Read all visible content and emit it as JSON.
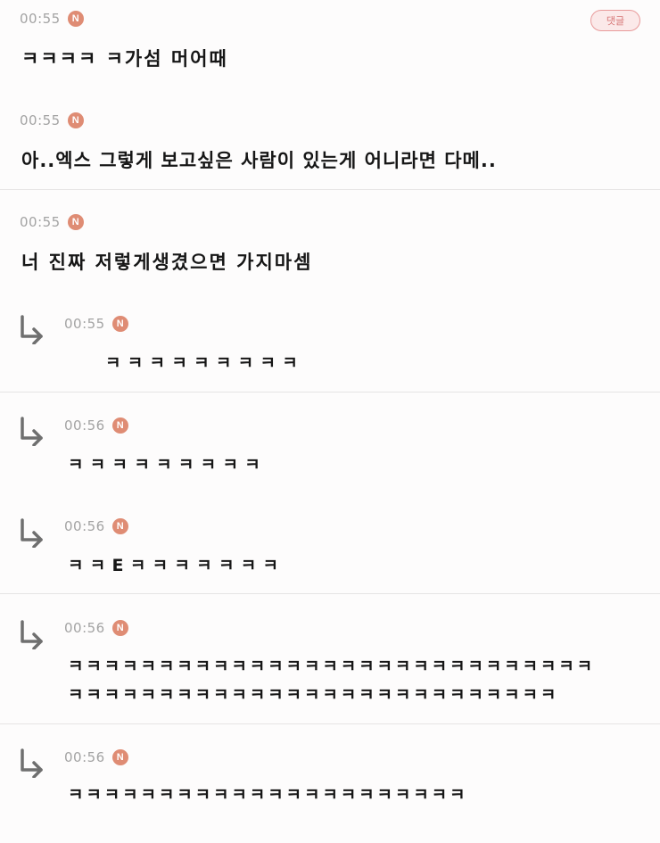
{
  "reply_button_label": "댓글",
  "comments": [
    {
      "time": "00:55",
      "badge": "N",
      "text": "ㅋㅋㅋㅋ ㅋ가섬 머어때"
    },
    {
      "time": "00:55",
      "badge": "N",
      "text": "아..엑스 그렇게 보고싶은 사람이 있는게 어니라면 다메.."
    },
    {
      "time": "00:55",
      "badge": "N",
      "text": "너 진짜 저렇게생겼으면 가지마셈"
    }
  ],
  "replies": [
    {
      "time": "00:55",
      "badge": "N",
      "lines": [
        "ㅋㅋㅋㅋㅋㅋㅋㅋㅋ"
      ]
    },
    {
      "time": "00:56",
      "badge": "N",
      "lines": [
        "ㅋㅋㅋㅋㅋㅋㅋㅋㅋ"
      ]
    },
    {
      "time": "00:56",
      "badge": "N",
      "lines": [
        "ㅋㅋEㅋㅋㅋㅋㅋㅋㅋ"
      ]
    },
    {
      "time": "00:56",
      "badge": "N",
      "lines": [
        "ㅋㅋㅋㅋㅋㅋㅋㅋㅋㅋㅋㅋㅋㅋㅋㅋㅋㅋㅋㅋㅋㅋㅋㅋㅋㅋㅋㅋㅋ",
        "ㅋㅋㅋㅋㅋㅋㅋㅋㅋㅋㅋㅋㅋㅋㅋㅋㅋㅋㅋㅋㅋㅋㅋㅋㅋㅋㅋ"
      ]
    },
    {
      "time": "00:56",
      "badge": "N",
      "lines": [
        "ㅋㅋㅋㅋㅋㅋㅋㅋㅋㅋㅋㅋㅋㅋㅋㅋㅋㅋㅋㅋㅋㅋ"
      ]
    }
  ]
}
